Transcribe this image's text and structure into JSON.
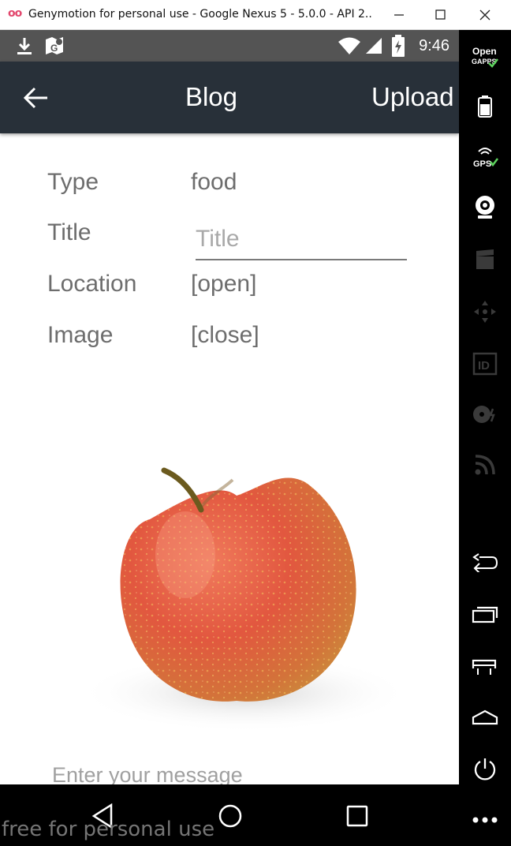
{
  "window": {
    "logo": "oo",
    "title": "Genymotion for personal use - Google Nexus 5 - 5.0.0 - API 2..."
  },
  "status_bar": {
    "time": "9:46",
    "left_icons": [
      "download-icon",
      "maps-icon"
    ],
    "right_icons": [
      "wifi-icon",
      "signal-icon",
      "battery-charging-icon"
    ]
  },
  "app_bar": {
    "title": "Blog",
    "action_label": "Upload"
  },
  "form": {
    "type_label": "Type",
    "type_value": "food",
    "title_label": "Title",
    "title_placeholder": "Title",
    "location_label": "Location",
    "location_value": "[open]",
    "image_label": "Image",
    "image_value": "[close]",
    "message_placeholder": "Enter your message"
  },
  "image": {
    "subject": "apple-photo"
  },
  "navigation": {
    "buttons": [
      "back-icon",
      "home-icon",
      "recents-icon"
    ]
  },
  "toolbar": {
    "open_gapps_label": "Open GAPPS",
    "gps_label": "GPS",
    "id_label": "ID",
    "tools": [
      "open-gapps-icon",
      "battery-icon",
      "gps-icon",
      "webcam-icon",
      "clapper-icon",
      "dpad-icon",
      "id-icon",
      "disk-icon",
      "cast-icon",
      "back-icon",
      "recents-icon",
      "menu-icon",
      "home-icon",
      "power-icon",
      "more-icon"
    ]
  },
  "watermark": "free for personal use",
  "colors": {
    "app_bar": "#283039",
    "status_bar": "#545454",
    "label_text": "#6d6d6d",
    "toolbar": "#000000",
    "logo": "#e2476d"
  }
}
